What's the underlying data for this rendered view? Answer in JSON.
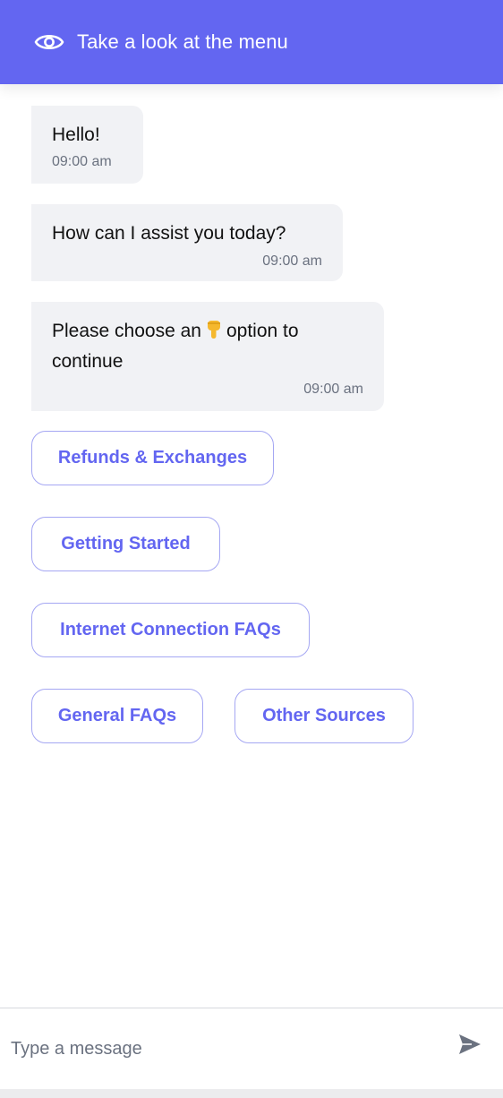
{
  "header": {
    "title": "Take a look at the menu",
    "icon": "eye-icon",
    "background": "#6366f1"
  },
  "messages": [
    {
      "text": "Hello!",
      "time": "09:00 am"
    },
    {
      "text": "How can I assist you today?",
      "time": "09:00 am"
    },
    {
      "text_before": "Please choose an",
      "emoji": "pointing-down-emoji",
      "text_after": "option to continue",
      "time": "09:00 am"
    }
  ],
  "options": [
    {
      "label": "Refunds & Exchanges"
    },
    {
      "label": "Getting Started"
    },
    {
      "label": "Internet Connection FAQs"
    },
    {
      "label": "General FAQs"
    },
    {
      "label": "Other Sources"
    }
  ],
  "composer": {
    "placeholder": "Type a message",
    "value": "",
    "send_icon": "send-icon"
  },
  "colors": {
    "accent": "#6366f1",
    "bubble": "#f1f2f5",
    "option_border": "#a5a7f3"
  }
}
